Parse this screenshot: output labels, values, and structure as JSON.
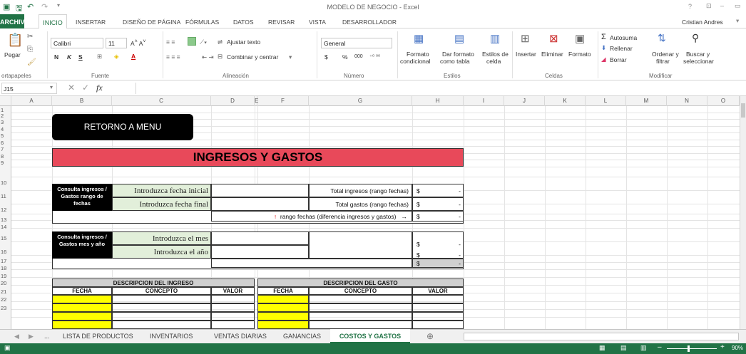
{
  "title": "MODELO DE NEGOCIO - Excel",
  "user": "Cristian Andres",
  "tabs": [
    "ARCHIVO",
    "INICIO",
    "INSERTAR",
    "DISEÑO DE PÁGINA",
    "FÓRMULAS",
    "DATOS",
    "REVISAR",
    "VISTA",
    "DESARROLLADOR"
  ],
  "ribbon": {
    "pegar": "Pegar",
    "portapapeles": "ortapapeles",
    "font_name": "Calibri",
    "font_size": "11",
    "bold": "N",
    "italic": "K",
    "underline": "S",
    "fuente": "Fuente",
    "ajustar": "Ajustar texto",
    "combinar": "Combinar y centrar",
    "alineacion": "Alineación",
    "number_format": "General",
    "currency": "$",
    "percent": "%",
    "thousands": "000",
    "numero": "Número",
    "formato_cond_1": "Formato",
    "formato_cond_2": "condicional",
    "formato_tabla_1": "Dar formato",
    "formato_tabla_2": "como tabla",
    "estilos_celda_1": "Estilos de",
    "estilos_celda_2": "celda",
    "estilos": "Estilos",
    "insertar": "Insertar",
    "eliminar": "Eliminar",
    "formato": "Formato",
    "celdas": "Celdas",
    "autosuma": "Autosuma",
    "rellenar": "Rellenar",
    "borrar": "Borrar",
    "ordenar_1": "Ordenar y",
    "ordenar_2": "filtrar",
    "buscar_1": "Buscar y",
    "buscar_2": "seleccionar",
    "modificar": "Modificar"
  },
  "namebox": "J15",
  "fx": "fx",
  "columns": [
    "A",
    "B",
    "C",
    "D",
    "E",
    "F",
    "G",
    "H",
    "I",
    "J",
    "K",
    "L",
    "M",
    "N",
    "O"
  ],
  "rows": [
    "1",
    "2",
    "3",
    "4",
    "5",
    "6",
    "7",
    "8",
    "9",
    "10",
    "11",
    "12",
    "13",
    "14",
    "15",
    "16",
    "17",
    "18",
    "19",
    "20",
    "21",
    "22",
    "23"
  ],
  "sheet": {
    "retorno": "RETORNO A MENU",
    "title": "INGRESOS Y GASTOS",
    "consulta_rango": "Consulta ingresos / Gastos rango de fechas",
    "fecha_inicial": "Introduzca fecha inicial",
    "fecha_final": "Introduzca fecha final",
    "total_ingresos": "Total ingresos (rango fechas)",
    "total_gastos": "Total gastos (rango fechas)",
    "diferencia": "rango fechas (diferencia ingresos y gastos)",
    "dollar": "$",
    "dash": "-",
    "consulta_mes": "Consulta ingresos / Gastos mes y año",
    "intro_mes": "Introduzca el mes",
    "intro_anio": "Introduzca el año",
    "desc_ingreso": "DESCRIPCION DEL INGRESO",
    "desc_gasto": "DESCRIPCION DEL GASTO",
    "fecha": "FECHA",
    "concepto": "CONCEPTO",
    "valor": "VALOR"
  },
  "sheet_tabs": [
    "LISTA DE PRODUCTOS",
    "INVENTARIOS",
    "VENTAS DIARIAS",
    "GANANCIAS",
    "COSTOS Y GASTOS"
  ],
  "ellipsis": "...",
  "zoom": "90%",
  "colors": {
    "excel_green": "#217346",
    "title_red": "#e8495a",
    "input_green": "#e2efda",
    "yellow": "#ffff00"
  }
}
